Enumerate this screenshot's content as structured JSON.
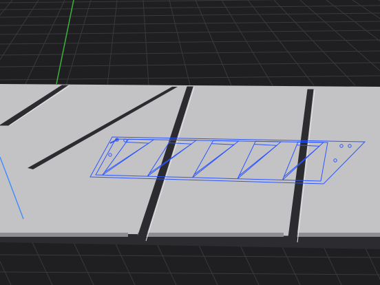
{
  "viewport": {
    "kind": "3d-cad-viewport",
    "background_color": "#1f1f21",
    "grid_color": "#3a3a3e",
    "y_axis_color": "#3cab3a",
    "x_axis_color": "#3a8cff"
  },
  "model": {
    "panel_color": "#c3c3c6",
    "panel_edge_color": "#8e8e92",
    "groove_color": "#2c2c30",
    "panel_count": 4
  },
  "selection": {
    "highlight_color": "#2d55ff",
    "selected_object": "diagonal-truss-sketch",
    "truss_bays": 5
  }
}
